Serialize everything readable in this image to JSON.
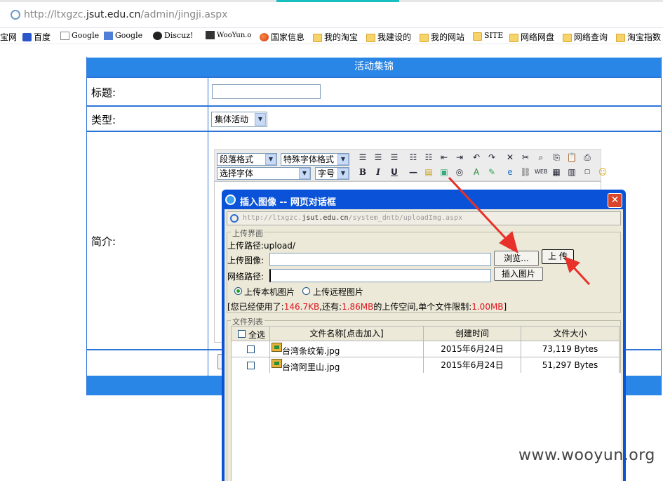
{
  "browser": {
    "url_prefix": "http://ltxgzc.",
    "url_host": "jsut.edu.cn",
    "url_path": "/admin/jingji.aspx"
  },
  "bookmarks": [
    {
      "label": "宝网",
      "icon": "none"
    },
    {
      "label": "百度",
      "icon": "baidu-paw-icon"
    },
    {
      "label": "Google",
      "icon": "page-icon"
    },
    {
      "label": "Google",
      "icon": "google-icon"
    },
    {
      "label": "Discuz!",
      "icon": "discuz-icon"
    },
    {
      "label": "WooYun.o",
      "icon": "wooyun-icon"
    },
    {
      "label": "国家信息",
      "icon": "globe-icon"
    },
    {
      "label": "我的淘宝",
      "icon": "folder-icon"
    },
    {
      "label": "我建设的",
      "icon": "folder-icon"
    },
    {
      "label": "我的网站",
      "icon": "folder-icon"
    },
    {
      "label": "SITE",
      "icon": "folder-icon"
    },
    {
      "label": "网络网盘",
      "icon": "folder-icon"
    },
    {
      "label": "网络查询",
      "icon": "folder-icon"
    },
    {
      "label": "淘宝指数",
      "icon": "folder-icon"
    }
  ],
  "form": {
    "header": "活动集锦",
    "title_label": "标题:",
    "type_label": "类型:",
    "type_value": "集体活动",
    "intro_label": "简介:"
  },
  "editor": {
    "paragraph_format": "段落格式",
    "special_font_format": "特殊字体格式",
    "select_font": "选择字体",
    "font_size": "字号",
    "bold": "B",
    "italic": "I",
    "underline": "U"
  },
  "dialog": {
    "title": "插入图像 -- 网页对话框",
    "url_prefix": "http://ltxgzc.",
    "url_host": "jsut.edu.cn",
    "url_path": "/system_dntb/uploadImg.aspx",
    "upload_section": "上传界面",
    "upload_path_label": "上传路径:",
    "upload_path_value": "upload/",
    "upload_image_label": "上传图像:",
    "network_path_label": "网络路径:",
    "browse_button": "浏览...",
    "upload_button": "上 传",
    "insert_button": "插入图片",
    "radio_local": "上传本机图片",
    "radio_remote": "上传远程图片",
    "usage_prefix": "[您已经使用了:",
    "used": "146.7KB",
    "usage_mid": ",还有:",
    "remaining": "1.86MB",
    "usage_mid2": "的上传空间,单个文件限制:",
    "limit": "1.00MB",
    "usage_suffix": "]",
    "file_list_section": "文件列表",
    "columns": [
      "全选",
      "文件名称[点击加入]",
      "创建时间",
      "文件大小"
    ],
    "files": [
      {
        "name": "台湾条纹菊.jpg",
        "date": "2015年6月24日",
        "size": "73,119 Bytes"
      },
      {
        "name": "台湾阿里山.jpg",
        "date": "2015年6月24日",
        "size": "51,297 Bytes"
      }
    ]
  },
  "watermark": "www.wooyun.org",
  "colors": {
    "header_blue": "#2a86e6",
    "dialog_blue": "#0a53d8",
    "arrow_red": "#e8312a",
    "highlight_red": "#e0141e"
  }
}
